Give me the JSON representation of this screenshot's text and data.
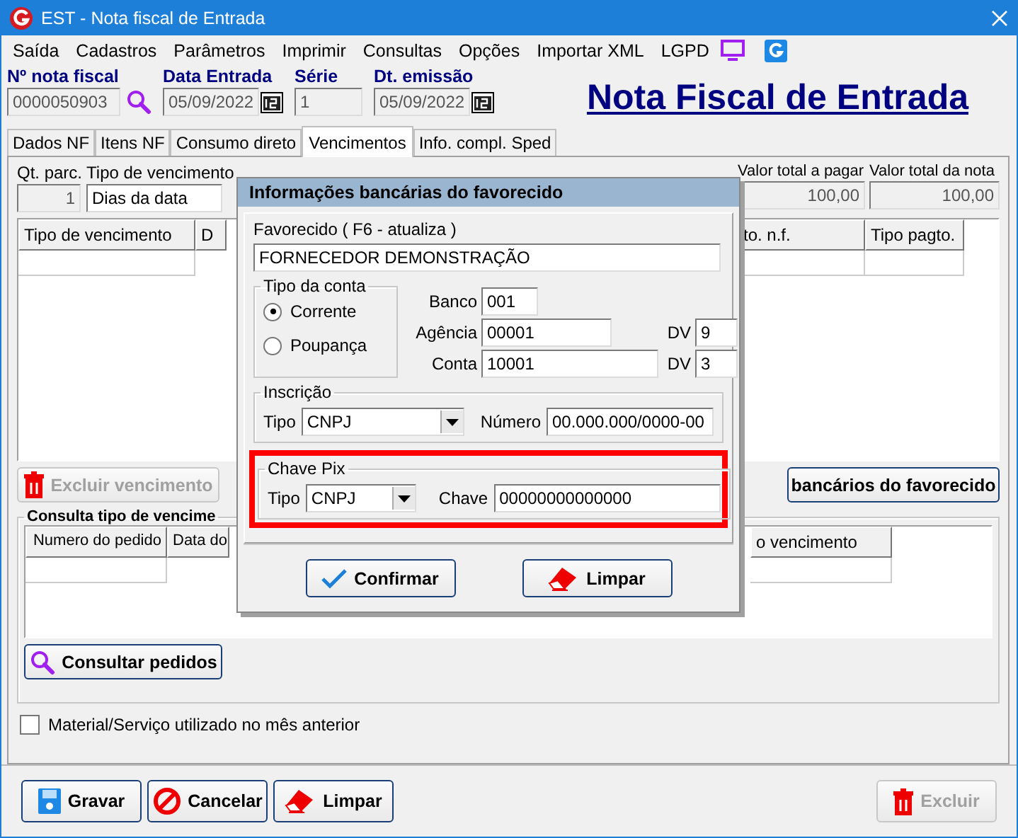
{
  "window": {
    "title": "EST - Nota fiscal de Entrada"
  },
  "menu": [
    "Saída",
    "Cadastros",
    "Parâmetros",
    "Imprimir",
    "Consultas",
    "Opções",
    "Importar XML",
    "LGPD"
  ],
  "header": {
    "fields": [
      {
        "label": "Nº nota fiscal",
        "value": "0000050903",
        "kind": "search"
      },
      {
        "label": "Data Entrada",
        "value": "05/09/2022",
        "kind": "date"
      },
      {
        "label": "Série",
        "value": "1",
        "kind": "text"
      },
      {
        "label": "Dt. emissão",
        "value": "05/09/2022",
        "kind": "date"
      }
    ],
    "title": "Nota Fiscal de Entrada"
  },
  "tabs": [
    {
      "label": "Dados NF",
      "selected": false
    },
    {
      "label": "Itens NF",
      "selected": false
    },
    {
      "label": "Consumo direto",
      "selected": false
    },
    {
      "label": "Vencimentos",
      "selected": true
    },
    {
      "label": "Info. compl. Sped",
      "selected": false
    }
  ],
  "vencimentos": {
    "qt_parc_label": "Qt. parc.",
    "qt_parc": "1",
    "tipo_label": "Tipo de vencimento",
    "tipo": "Dias da data",
    "valor_pagar_label": "Valor total a pagar",
    "valor_pagar": "100,00",
    "valor_nota_label": "Valor total da nota",
    "valor_nota": "100,00",
    "table": {
      "columns": [
        "Tipo de vencimento",
        "D"
      ],
      "right_columns": [
        "to. n.f.",
        "Tipo pagto."
      ]
    },
    "excluir_button": {
      "label": "Excluir vencimento",
      "disabled": true
    },
    "bank_button": "bancários do favorecido",
    "consulta": {
      "title": "Consulta tipo de vencime",
      "columns": [
        "Numero do pedido",
        "Data do"
      ],
      "right_columns": [
        "o vencimento"
      ],
      "button": "Consultar pedidos"
    },
    "material_checkbox": {
      "label": "Material/Serviço utilizado no mês anterior",
      "checked": false
    }
  },
  "footer": [
    {
      "label": "Gravar",
      "kind": "save",
      "disabled": false
    },
    {
      "label": "Cancelar",
      "kind": "cancel",
      "disabled": false
    },
    {
      "label": "Limpar",
      "kind": "clear",
      "disabled": false
    },
    {
      "label": "Excluir",
      "kind": "delete",
      "disabled": true
    }
  ],
  "dialog": {
    "title": "Informações bancárias do favorecido",
    "favorecido_label": "Favorecido ( F6 - atualiza )",
    "favorecido": "FORNECEDOR DEMONSTRAÇÃO",
    "tipo_conta": {
      "title": "Tipo da conta",
      "options": [
        {
          "label": "Corrente",
          "selected": true
        },
        {
          "label": "Poupança",
          "selected": false
        }
      ]
    },
    "banco_label": "Banco",
    "banco": "001",
    "agencia_label": "Agência",
    "agencia": "00001",
    "agencia_dv_label": "DV",
    "agencia_dv": "9",
    "conta_label": "Conta",
    "conta": "10001",
    "conta_dv_label": "DV",
    "conta_dv": "3",
    "inscricao": {
      "title": "Inscrição",
      "tipo_label": "Tipo",
      "tipo": "CNPJ",
      "numero_label": "Número",
      "numero": "00.000.000/0000-00"
    },
    "pix": {
      "title": "Chave Pix",
      "tipo_label": "Tipo",
      "tipo": "CNPJ",
      "chave_label": "Chave",
      "chave": "00000000000000",
      "highlighted": true
    },
    "buttons": [
      {
        "label": "Confirmar",
        "kind": "confirm"
      },
      {
        "label": "Limpar",
        "kind": "clear"
      }
    ]
  }
}
